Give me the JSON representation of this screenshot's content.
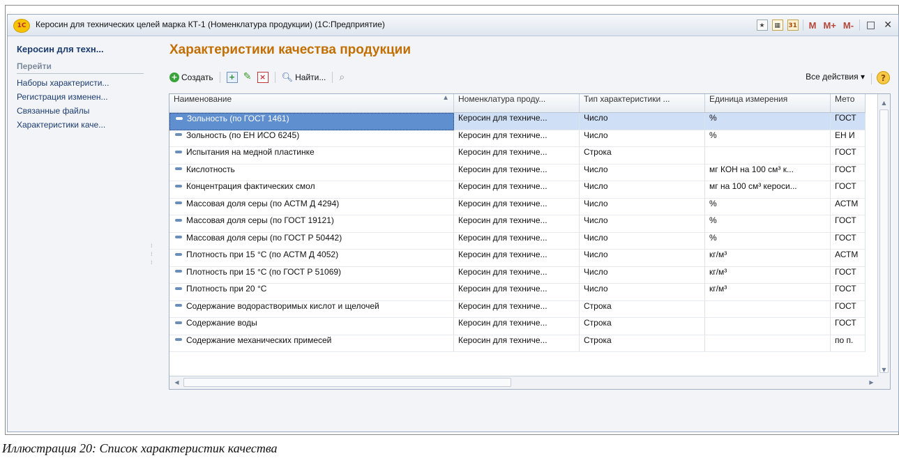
{
  "window": {
    "logo_text": "1С",
    "title": "Керосин для технических целей марка КТ-1 (Номенклатура продукции)  (1С:Предприятие)",
    "controls": {
      "mem_m": "M",
      "mem_plus": "M+",
      "mem_minus": "M-",
      "calendar_text": "31",
      "restore": "□",
      "close": "✕"
    }
  },
  "sidebar": {
    "title": "Керосин для техн...",
    "goto_label": "Перейти",
    "links": [
      "Наборы характеристи...",
      "Регистрация изменен...",
      "Связанные файлы",
      "Характеристики каче..."
    ]
  },
  "content": {
    "title": "Характеристики качества продукции",
    "toolbar": {
      "create_label": "Создать",
      "find_label": "Найти...",
      "all_actions_label": "Все действия ▾",
      "help_label": "?"
    },
    "table": {
      "columns": [
        "Наименование",
        "Номенклатура проду...",
        "Тип характеристики ...",
        "Единица измерения",
        "Мето"
      ],
      "rows": [
        [
          "Зольность (по ГОСТ 1461)",
          "Керосин для техниче...",
          "Число",
          "%",
          "ГОСТ"
        ],
        [
          "Зольность (по ЕН ИСО 6245)",
          "Керосин для техниче...",
          "Число",
          "%",
          "ЕН И"
        ],
        [
          "Испытания на медной пластинке",
          "Керосин для техниче...",
          "Строка",
          "",
          "ГОСТ"
        ],
        [
          "Кислотность",
          "Керосин для техниче...",
          "Число",
          "мг КОН на 100 см³ к...",
          "ГОСТ"
        ],
        [
          "Концентрация фактических смол",
          "Керосин для техниче...",
          "Число",
          "мг на 100 см³ кероси...",
          "ГОСТ"
        ],
        [
          "Массовая доля серы (по АСТМ Д 4294)",
          "Керосин для техниче...",
          "Число",
          "%",
          "АСТМ"
        ],
        [
          "Массовая доля серы (по ГОСТ 19121)",
          "Керосин для техниче...",
          "Число",
          "%",
          "ГОСТ"
        ],
        [
          "Массовая доля серы (по ГОСТ Р 50442)",
          "Керосин для техниче...",
          "Число",
          "%",
          "ГОСТ"
        ],
        [
          "Плотность при 15 °С (по АСТМ Д 4052)",
          "Керосин для техниче...",
          "Число",
          "кг/м³",
          "АСТМ"
        ],
        [
          "Плотность при 15 °С (по ГОСТ Р 51069)",
          "Керосин для техниче...",
          "Число",
          "кг/м³",
          "ГОСТ"
        ],
        [
          "Плотность при 20 °С",
          "Керосин для техниче...",
          "Число",
          "кг/м³",
          "ГОСТ"
        ],
        [
          "Содержание водорастворимых кислот и щелочей",
          "Керосин для техниче...",
          "Строка",
          "",
          "ГОСТ"
        ],
        [
          "Содержание воды",
          "Керосин для техниче...",
          "Строка",
          "",
          "ГОСТ"
        ],
        [
          "Содержание механических примесей",
          "Керосин для техниче...",
          "Строка",
          "",
          "по п."
        ]
      ],
      "selected_row": 0
    }
  },
  "caption": "Иллюстрация 20: Список характеристик качества",
  "colors": {
    "title_orange": "#c36f00",
    "link_blue": "#1b3b6f",
    "selection": "#5f8fcf"
  }
}
